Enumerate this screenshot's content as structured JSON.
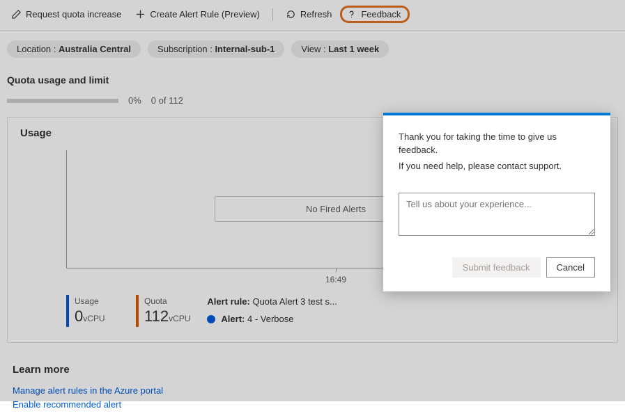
{
  "toolbar": {
    "quota_increase": "Request quota increase",
    "create_alert_rule": "Create Alert Rule (Preview)",
    "refresh": "Refresh",
    "feedback": "Feedback"
  },
  "filters": {
    "location_label": "Location :",
    "location_value": "Australia Central",
    "subscription_label": "Subscription :",
    "subscription_value": "Internal-sub-1",
    "view_label": "View :",
    "view_value": "Last 1 week"
  },
  "quota": {
    "title": "Quota usage and limit",
    "percent": "0%",
    "count": "0 of 112"
  },
  "usage": {
    "title": "Usage",
    "no_alerts": "No Fired Alerts",
    "x_tick": "16:49",
    "usage_label": "Usage",
    "usage_value": "0",
    "usage_unit": "vCPU",
    "quota_label": "Quota",
    "quota_value": "112",
    "quota_unit": "vCPU",
    "alert_rule_label": "Alert rule:",
    "alert_rule_value": "Quota Alert 3 test s...",
    "alert_label": "Alert:",
    "alert_value": "4 - Verbose"
  },
  "learn": {
    "title": "Learn more",
    "link1": "Manage alert rules in the Azure portal",
    "link2": "Enable recommended alert"
  },
  "dialog": {
    "line1": "Thank you for taking the time to give us feedback.",
    "line2": "If you need help, please contact support.",
    "placeholder": "Tell us about your experience...",
    "submit": "Submit feedback",
    "cancel": "Cancel"
  }
}
